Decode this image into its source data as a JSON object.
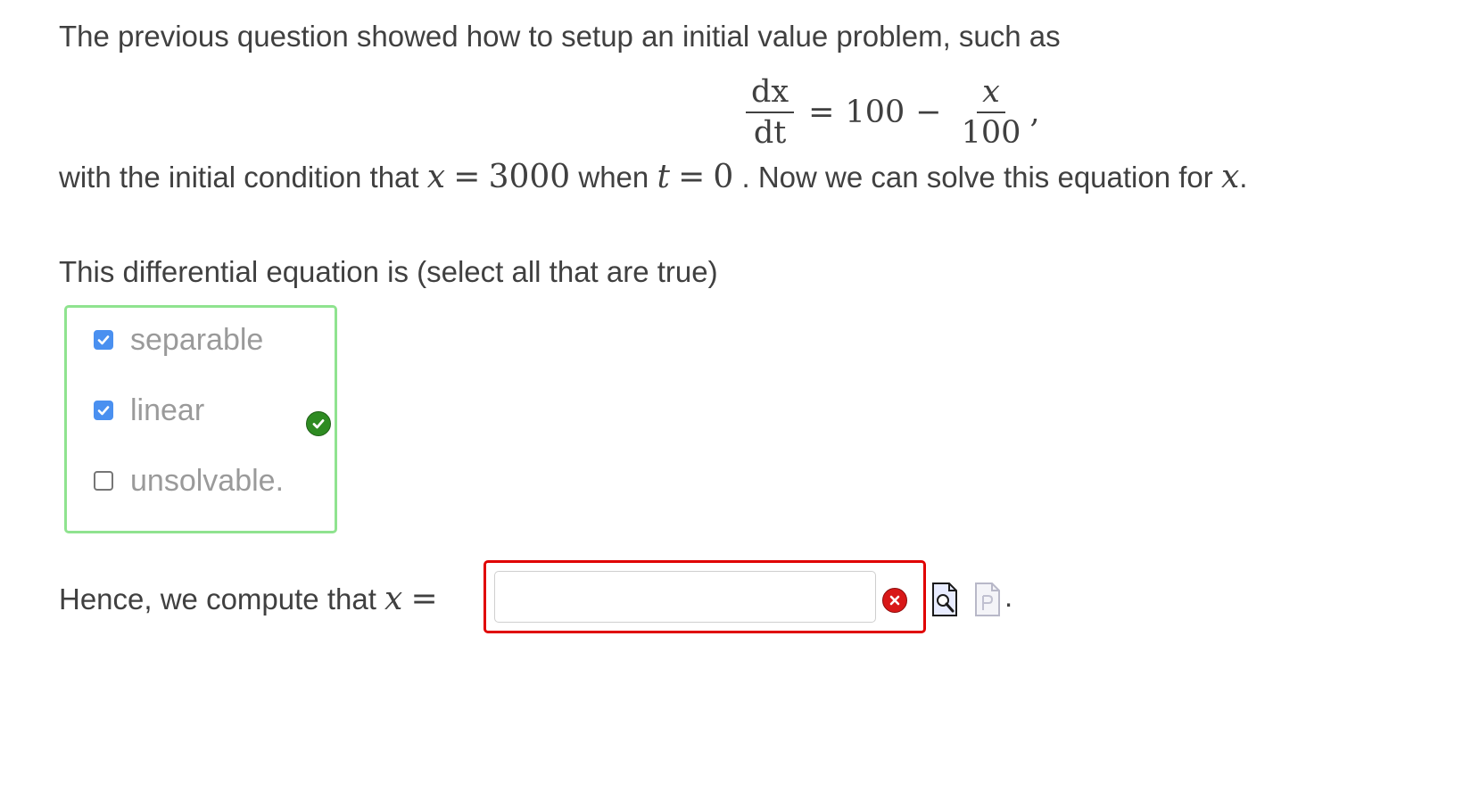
{
  "intro": {
    "text": "The previous question showed how to setup an initial value problem, such as"
  },
  "equation": {
    "lhs_numerator": "dx",
    "lhs_denominator": "dt",
    "equals": "=",
    "constant": "100",
    "minus": "−",
    "rhs_numerator": "x",
    "rhs_denominator": "100",
    "trailing": ","
  },
  "condition": {
    "prefix": "with the initial condition that",
    "var_x": "x",
    "eq1": "=",
    "x_value": "3000",
    "when": "when",
    "var_t": "t",
    "eq2": "=",
    "t_value": "0",
    "middle": ". Now we can solve this equation for",
    "var_x_end": "x",
    "suffix": "."
  },
  "prompt": {
    "text": "This differential equation is (select all that are true)"
  },
  "choices": [
    {
      "label": "separable",
      "checked": true
    },
    {
      "label": "linear",
      "checked": true
    },
    {
      "label": "unsolvable.",
      "checked": false
    }
  ],
  "choices_status": "correct",
  "answer": {
    "label": "Hence, we compute that",
    "var": "x",
    "equals": "=",
    "value": "",
    "placeholder": "",
    "status": "incorrect",
    "trailing": "."
  },
  "colors": {
    "correct_border": "#8fe38f",
    "incorrect_border": "#e00000",
    "checkbox_checked": "#4a90f0",
    "correct_icon": "#2e8b22",
    "incorrect_icon": "#d81818"
  },
  "icons": {
    "correct": "checkmark-circle-icon",
    "incorrect": "x-circle-icon",
    "preview": "preview-document-magnifier-icon",
    "pg_file": "pg-document-icon"
  }
}
